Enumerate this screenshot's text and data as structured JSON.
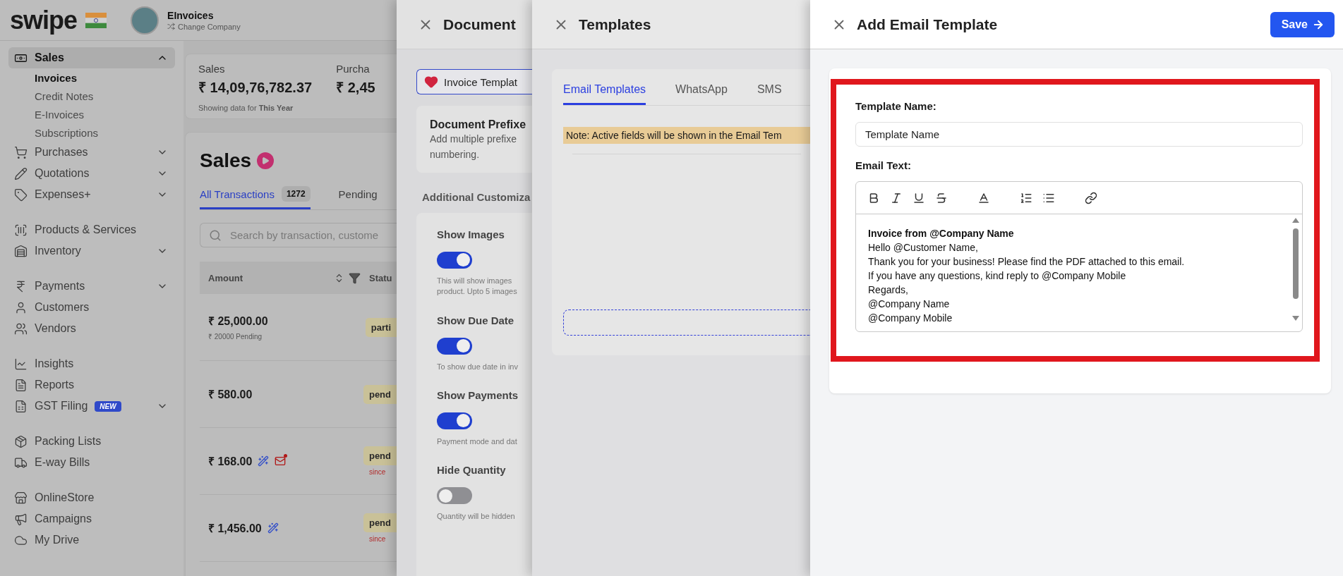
{
  "header": {
    "logo": "swipe",
    "company": "EInvoices",
    "change_company": "Change Company"
  },
  "sidebar": {
    "groups": [
      {
        "items": [
          {
            "label": "Sales",
            "expanded": true,
            "selected": true,
            "children": [
              {
                "label": "Invoices",
                "selected": true
              },
              {
                "label": "Credit Notes",
                "selected": false
              },
              {
                "label": "E-Invoices",
                "selected": false
              },
              {
                "label": "Subscriptions",
                "selected": false
              }
            ]
          },
          {
            "label": "Purchases",
            "expanded": false,
            "selected": false
          },
          {
            "label": "Quotations",
            "expanded": false,
            "selected": false
          },
          {
            "label": "Expenses+",
            "expanded": false,
            "selected": false
          }
        ]
      },
      {
        "items": [
          {
            "label": "Products & Services",
            "selected": false
          },
          {
            "label": "Inventory",
            "expanded": false,
            "selected": false
          }
        ]
      },
      {
        "items": [
          {
            "label": "Payments",
            "expanded": false,
            "selected": false
          },
          {
            "label": "Customers",
            "selected": false
          },
          {
            "label": "Vendors",
            "selected": false
          }
        ]
      },
      {
        "items": [
          {
            "label": "Insights",
            "selected": false
          },
          {
            "label": "Reports",
            "selected": false
          },
          {
            "label": "GST Filing",
            "badge": "NEW",
            "expanded": false,
            "selected": false
          }
        ]
      },
      {
        "items": [
          {
            "label": "Packing Lists",
            "selected": false
          },
          {
            "label": "E-way Bills",
            "selected": false
          }
        ]
      },
      {
        "items": [
          {
            "label": "OnlineStore",
            "selected": false
          },
          {
            "label": "Campaigns",
            "selected": false
          },
          {
            "label": "My Drive",
            "selected": false
          }
        ]
      }
    ]
  },
  "summary": [
    {
      "label": "Sales",
      "value": "₹ 14,09,76,782.37",
      "note": "Showing data for **This Year**"
    },
    {
      "label": "Purcha",
      "value": "₹ 2,45"
    }
  ],
  "sales": {
    "title": "Sales",
    "tabs": [
      {
        "label": "All Transactions",
        "count": "1272",
        "selected": true
      },
      {
        "label": "Pending",
        "selected": false
      }
    ],
    "search": {
      "placeholder": "Search by transaction, custome"
    },
    "columns": [
      "Amount",
      "Statu"
    ],
    "rows": [
      {
        "amount": "₹ 25,000.00",
        "pending": "₹ 20000 Pending",
        "magic": false,
        "emailed": false,
        "status": "parti"
      },
      {
        "amount": "₹ 580.00",
        "magic": false,
        "emailed": false,
        "status": "pend"
      },
      {
        "amount": "₹ 168.00",
        "magic": true,
        "emailed": true,
        "status": "pend",
        "since": "since"
      },
      {
        "amount": "₹ 1,456.00",
        "magic": true,
        "emailed": false,
        "status": "pend",
        "since": "since"
      }
    ]
  },
  "document_settings": {
    "title": "Document",
    "template_button": "Invoice Templat",
    "prefix_card": {
      "title": "Document Prefixe",
      "lines": [
        "Add multiple prefixe",
        "numbering."
      ]
    },
    "section_title": "Additional Customiza",
    "options": [
      {
        "label": "Show Images",
        "on": true,
        "description": [
          "This will show images",
          "product. Upto 5 images"
        ]
      },
      {
        "label": "Show Due Date",
        "on": true,
        "description": [
          "To show due date in inv"
        ]
      },
      {
        "label": "Show Payments",
        "on": true,
        "description": [
          "Payment mode and dat"
        ]
      },
      {
        "label": "Hide Quantity",
        "on": false,
        "description": [
          "Quantity will be hidden"
        ]
      }
    ]
  },
  "templates": {
    "title": "Templates",
    "tabs": [
      {
        "label": "Email Templates",
        "selected": true
      },
      {
        "label": "WhatsApp",
        "selected": false
      },
      {
        "label": "SMS",
        "selected": false
      }
    ],
    "note": "Note: Active fields will be shown in the Email Tem"
  },
  "add_email_template": {
    "title": "Add Email Template",
    "save": "Save",
    "name_label": "Template Name:",
    "name_placeholder": "Template Name",
    "text_label": "Email Text:",
    "editor": {
      "title": "Invoice from @Company Name",
      "lines": [
        "Hello @Customer Name,",
        "Thank you for your business! Please find the PDF attached to this email.",
        "If you have any questions, kind reply to @Company Mobile",
        "Regards,",
        "@Company Name",
        "@Company Mobile"
      ]
    }
  }
}
